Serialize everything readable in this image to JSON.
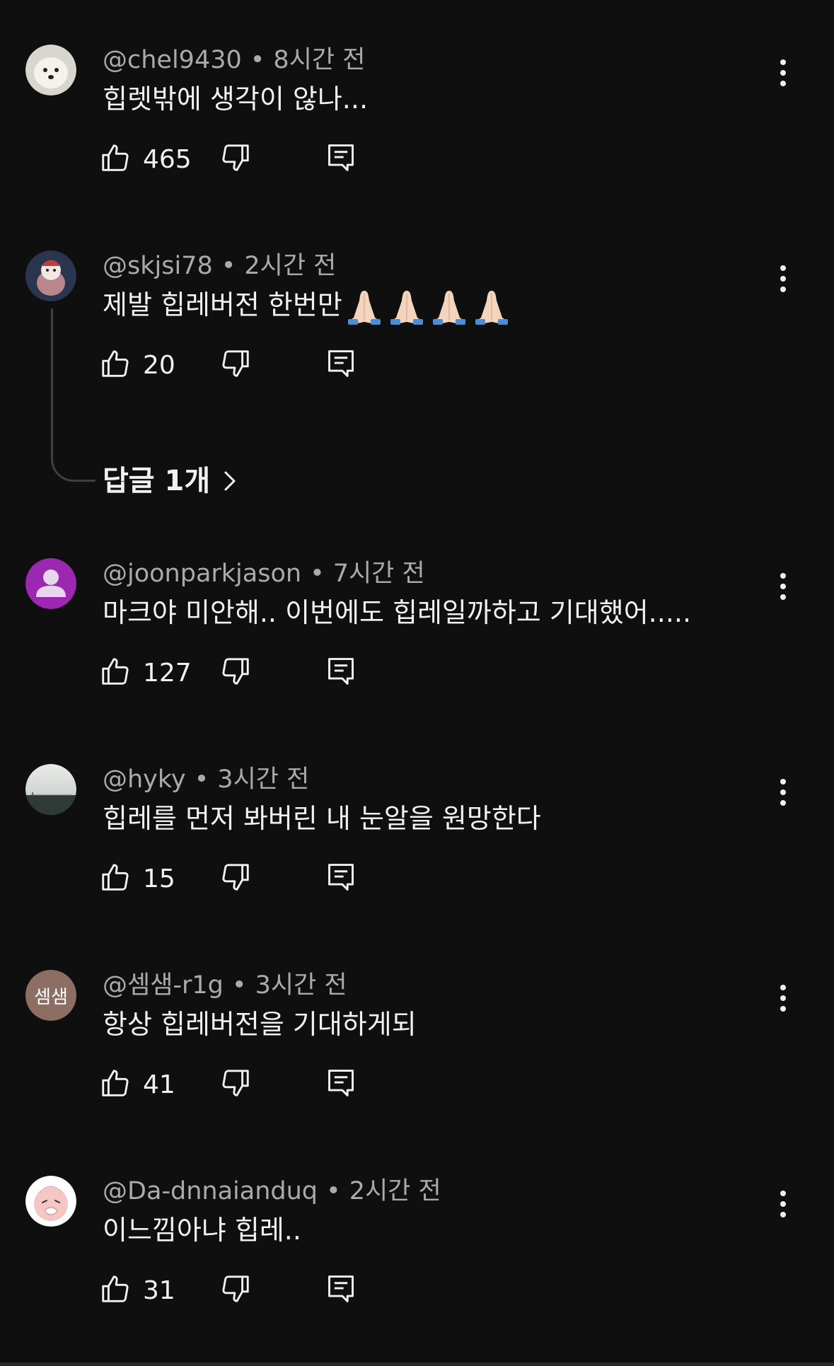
{
  "comments": [
    {
      "handle": "@chel9430",
      "time": "8시간 전",
      "text": "힙렛밖에 생각이 않나...",
      "likes": "465"
    },
    {
      "handle": "@skjsi78",
      "time": "2시간 전",
      "text": "제발 힙레버전 한번만",
      "emoji": "🙏🙏🙏🙏",
      "likes": "20",
      "replies_label": "답글 1개"
    },
    {
      "handle": "@joonparkjason",
      "time": "7시간 전",
      "text": "마크야 미안해.. 이번에도 힙레일까하고 기대했어.....",
      "likes": "127"
    },
    {
      "handle": "@hyky",
      "time": "3시간 전",
      "text": "힙레를 먼저 봐버린 내 눈알을 원망한다",
      "likes": "15"
    },
    {
      "handle": "@셈샘-r1g",
      "time": "3시간 전",
      "text": "항상 힙레버전을 기대하게되",
      "likes": "41",
      "avatar_text": "셈샘"
    },
    {
      "handle": "@Da-dnnaianduq",
      "time": "2시간 전",
      "text": "이느낌아냐 힙레..",
      "likes": "31"
    }
  ],
  "separator": "•",
  "icons": {
    "like": "thumb-up-icon",
    "dislike": "thumb-down-icon",
    "reply": "reply-comment-icon",
    "more": "more-vertical-icon",
    "chevron": "chevron-right-icon"
  },
  "colors": {
    "background": "#0f0f0f",
    "text": "#f1f1f1",
    "meta": "#aaaaaa",
    "avatar_purple": "#9c27b0",
    "avatar_brown": "#8d6e63"
  }
}
